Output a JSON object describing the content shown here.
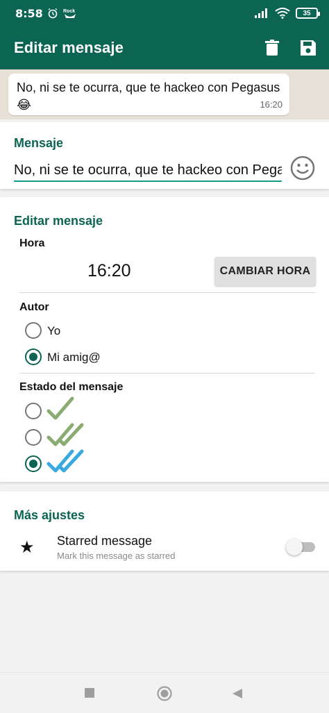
{
  "status_bar": {
    "time": "8:58",
    "battery": "35",
    "icons": [
      "alarm-icon",
      "rock-icon",
      "signal-icon",
      "wifi-icon",
      "battery-icon"
    ]
  },
  "app_bar": {
    "title": "Editar mensaje",
    "delete_icon": "trash-icon",
    "save_icon": "floppy-save-icon",
    "color": "#0c6453"
  },
  "preview": {
    "text": "No, ni se te ocurra, que te hackeo con Pegasus 😂",
    "time": "16:20"
  },
  "message_section": {
    "title": "Mensaje",
    "value": "No, ni se te ocurra, que te hackeo con Pegasus 😂",
    "emoji_icon": "smiley-icon",
    "accent": "#159c8a"
  },
  "edit_section": {
    "title": "Editar mensaje",
    "hora_label": "Hora",
    "hora_value": "16:20",
    "change_button": "CAMBIAR HORA",
    "autor_label": "Autor",
    "autor_options": [
      {
        "label": "Yo",
        "selected": false
      },
      {
        "label": "Mi amig@",
        "selected": true
      }
    ],
    "estado_label": "Estado del mensaje",
    "estado_options": [
      {
        "icon": "single-check-icon",
        "selected": false,
        "color": "#8aab72"
      },
      {
        "icon": "double-check-icon",
        "selected": false,
        "color": "#8aab72"
      },
      {
        "icon": "double-check-blue-icon",
        "selected": true,
        "color": "#3aa9e0"
      }
    ]
  },
  "more_section": {
    "title": "Más ajustes",
    "starred_title": "Starred message",
    "starred_subtitle": "Mark this message as starred",
    "starred_on": false
  },
  "nav_bar": {
    "icons": [
      "recents-square-icon",
      "home-circle-icon",
      "back-triangle-icon"
    ]
  }
}
